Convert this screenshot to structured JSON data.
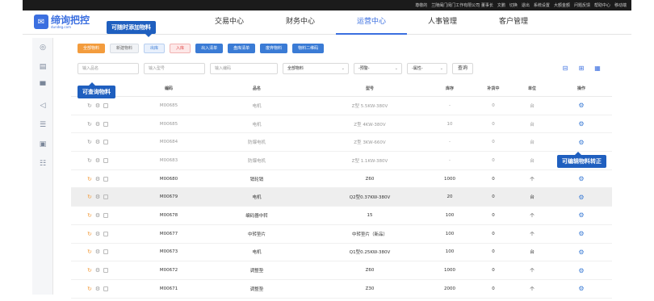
{
  "topbar": {
    "items": [
      "尊敬的",
      "兰陵闽门闵门工作有限公司 董事长",
      "文鹏",
      "切换",
      "退出",
      "系统设置",
      "大额金额",
      "问题反馈",
      "帮助中心",
      "移动端"
    ]
  },
  "logo": {
    "text": "缔询把控",
    "sub": "dundeg.com",
    "icon": "logo-icon"
  },
  "nav": [
    {
      "label": "交易中心"
    },
    {
      "label": "财务中心"
    },
    {
      "label": "运营中心"
    },
    {
      "label": "人事管理"
    },
    {
      "label": "客户管理"
    }
  ],
  "sidebar": {
    "icons": [
      "circle-icon",
      "chart-icon",
      "monitor-icon",
      "send-icon",
      "list-icon",
      "clipboard-icon",
      "document-icon"
    ]
  },
  "toolbar": {
    "buttons": [
      "全部物料",
      "新建物料",
      "出库",
      "入库",
      "出入清单",
      "盘库清单",
      "废弃物料",
      "物料二维码"
    ]
  },
  "filters": {
    "placeholders": [
      "输入品名",
      "输入型号",
      "输入编码"
    ],
    "selects": [
      "全部物料",
      "-预警-",
      "-属性-"
    ],
    "query": "查询"
  },
  "table": {
    "headers": [
      "编码",
      "品名",
      "型号",
      "库存",
      "补货中",
      "单位",
      "操作"
    ],
    "rows": [
      {
        "code": "M00685",
        "name": "电机",
        "model": "Z型 5.5KW-380V",
        "stock": "-",
        "qty": "0",
        "unit": "台"
      },
      {
        "code": "M00685",
        "name": "电机",
        "model": "Z型 4KW-380V",
        "stock": "10",
        "qty": "0",
        "unit": "台"
      },
      {
        "code": "M00684",
        "name": "防爆电机",
        "model": "Z型 3KW-660V",
        "stock": "-",
        "qty": "0",
        "unit": "台"
      },
      {
        "code": "M00683",
        "name": "防爆电机",
        "model": "Z型 1.1KW-380V",
        "stock": "-",
        "qty": "0",
        "unit": "台"
      },
      {
        "code": "M00680",
        "name": "销轮销",
        "model": "Z60",
        "stock": "1000",
        "qty": "0",
        "unit": "个"
      },
      {
        "code": "M00679",
        "name": "电机",
        "model": "Q2型0.37KW-380V",
        "stock": "20",
        "qty": "0",
        "unit": "台"
      },
      {
        "code": "M00678",
        "name": "编码器中转",
        "model": "15",
        "stock": "100",
        "qty": "0",
        "unit": "个"
      },
      {
        "code": "M00677",
        "name": "中转垫片",
        "model": "中转垫片（新品）",
        "stock": "100",
        "qty": "0",
        "unit": "个"
      },
      {
        "code": "M00673",
        "name": "电机",
        "model": "Q1型0.25KW-380V",
        "stock": "100",
        "qty": "0",
        "unit": "台"
      },
      {
        "code": "M00672",
        "name": "调整垫",
        "model": "Z60",
        "stock": "1000",
        "qty": "0",
        "unit": "个"
      },
      {
        "code": "M00671",
        "name": "调整垫",
        "model": "Z30",
        "stock": "2000",
        "qty": "0",
        "unit": "个"
      }
    ]
  },
  "callouts": {
    "add": "可随时添加物料",
    "search": "可查询物料",
    "edit": "可编辑物料转正"
  },
  "colors": {
    "accent": "#3b6fe0",
    "callout": "#1f5fbf",
    "warn": "#f39c3d"
  }
}
